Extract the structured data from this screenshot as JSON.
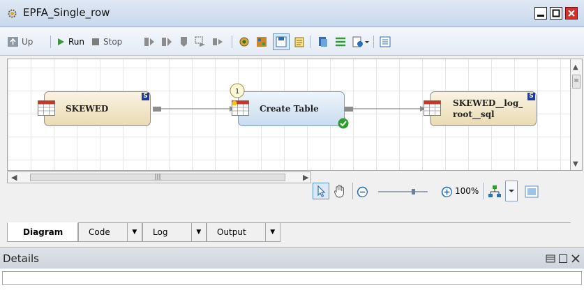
{
  "window": {
    "title": "EPFA_Single_row",
    "icon": "gear-cluster-icon",
    "controls": [
      "minimize-icon",
      "maximize-icon",
      "close-icon"
    ]
  },
  "toolbar": {
    "up_label": "Up",
    "run_label": "Run",
    "stop_label": "Stop",
    "icons": [
      "step-forward-icon",
      "step-multiple-icon",
      "step-down-icon",
      "step-selected-icon",
      "step-next-icon",
      "properties-icon",
      "map-icon",
      "save-icon",
      "notes-icon",
      "copy-icon",
      "list-icon",
      "run-options-icon",
      "task-list-icon"
    ]
  },
  "diagram": {
    "nodes": [
      {
        "label": "SKEWED",
        "badge": "S",
        "kind": "table"
      },
      {
        "label": "Create Table",
        "step_number": "1",
        "kind": "transform",
        "status": "success"
      },
      {
        "label_line1": "SKEWED__log_",
        "label_line2": "root__sql",
        "badge": "S",
        "kind": "table"
      }
    ]
  },
  "controls": {
    "zoom_value": "100%",
    "zoom_level_fraction": 0.7
  },
  "tabs": [
    {
      "label": "Diagram",
      "active": true,
      "has_dropdown": false
    },
    {
      "label": "Code",
      "active": false,
      "has_dropdown": true
    },
    {
      "label": "Log",
      "active": false,
      "has_dropdown": true
    },
    {
      "label": "Output",
      "active": false,
      "has_dropdown": true
    }
  ],
  "details": {
    "title": "Details",
    "value": ""
  },
  "colors": {
    "accent": "#2e6fb6",
    "run_green": "#2e9e2e",
    "badge_blue": "#1c3aa6",
    "close_red": "#d32f2f"
  }
}
